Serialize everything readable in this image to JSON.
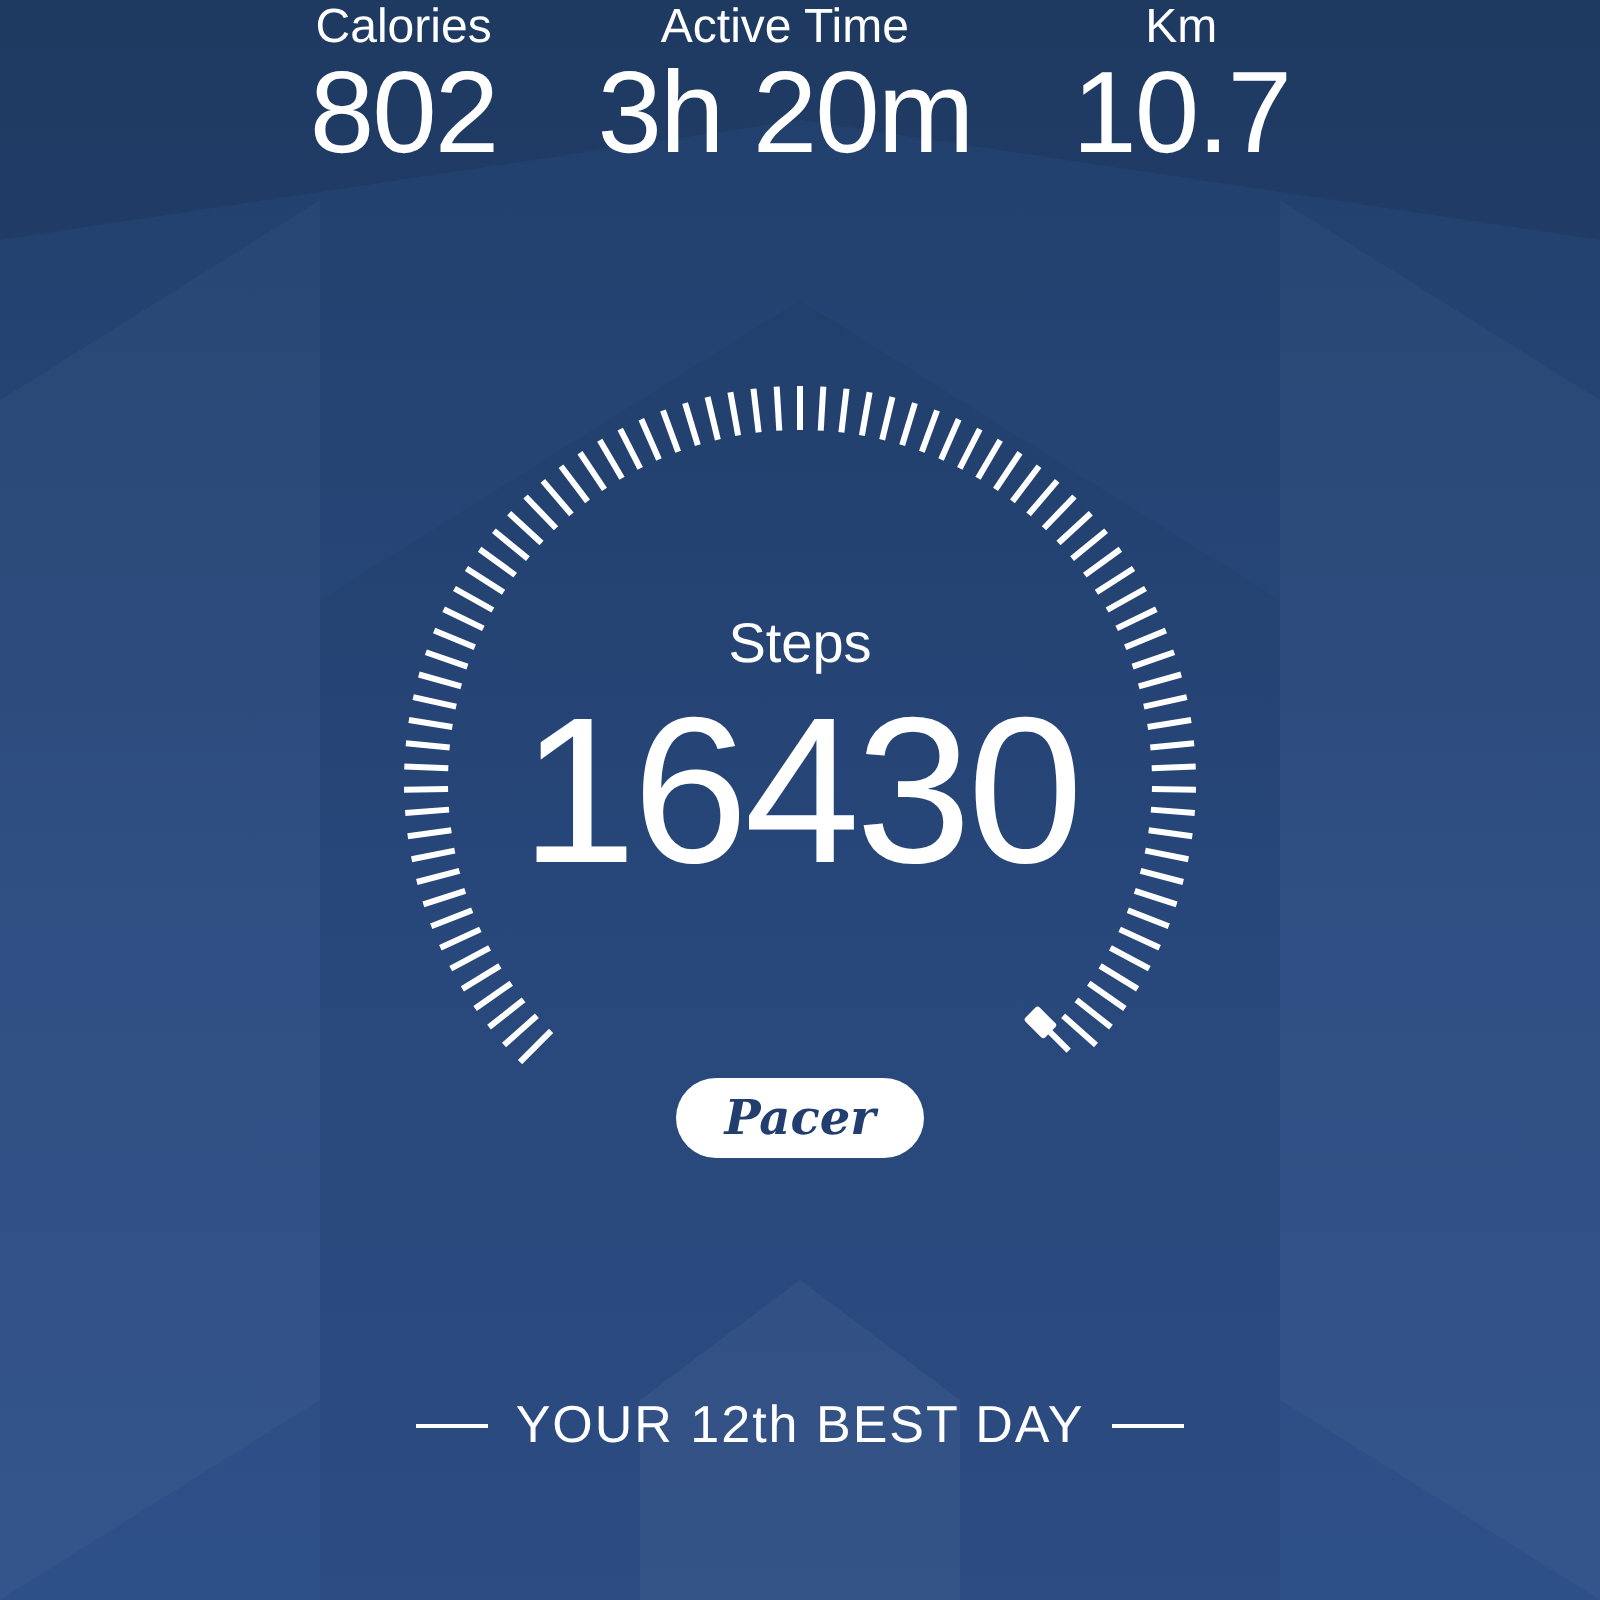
{
  "stats": [
    {
      "label": "Calories",
      "value": "802"
    },
    {
      "label": "Active Time",
      "value": "3h 20m"
    },
    {
      "label": "Km",
      "value": "10.7"
    }
  ],
  "gauge": {
    "label": "Steps",
    "value": "16430"
  },
  "logo": "Pacer",
  "banner": "YOUR 12th BEST DAY"
}
